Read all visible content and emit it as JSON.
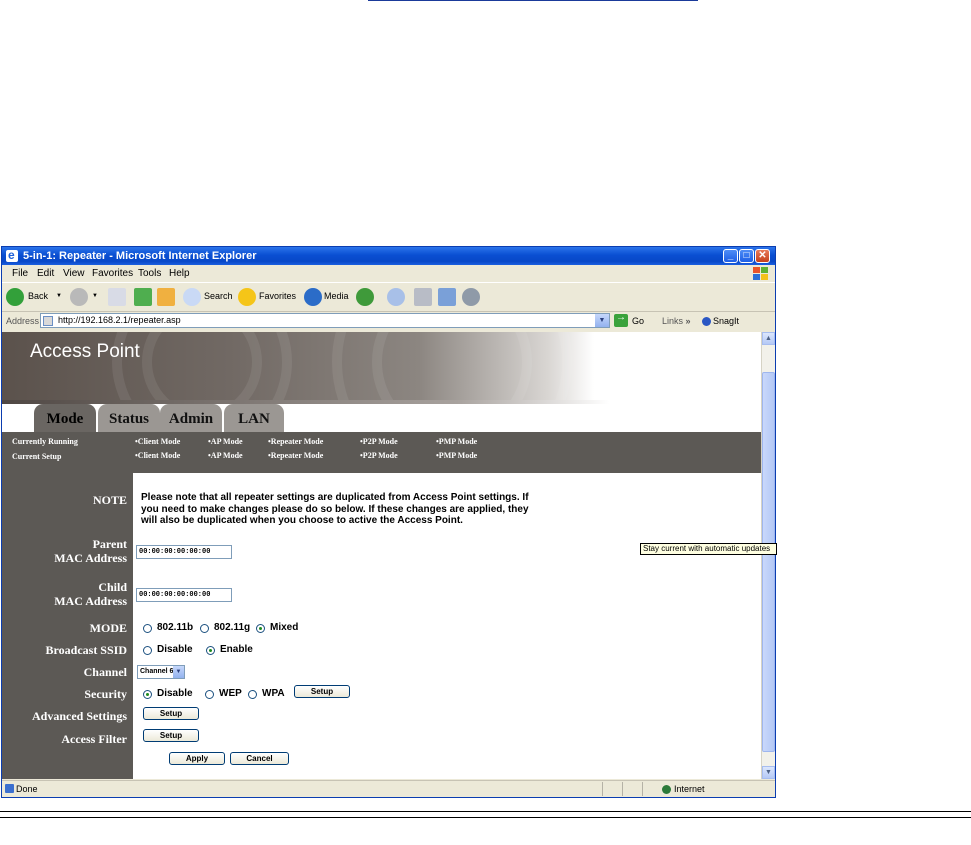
{
  "window": {
    "title": "5-in-1: Repeater - Microsoft Internet Explorer",
    "minimize": "_",
    "maximize": "□",
    "close": "✕"
  },
  "menu": [
    "File",
    "Edit",
    "View",
    "Favorites",
    "Tools",
    "Help"
  ],
  "toolbar": {
    "back": "Back",
    "search": "Search",
    "favorites": "Favorites",
    "media": "Media"
  },
  "address": {
    "label": "Address",
    "url": "http://192.168.2.1/repeater.asp",
    "go": "Go",
    "links": "Links",
    "links_more": "»",
    "snagit": "SnagIt"
  },
  "page": {
    "banner_title": "Access Point",
    "tabs": [
      "Mode",
      "Status",
      "Admin",
      "LAN"
    ],
    "currently_running_label": "Currently Running",
    "current_setup_label": "Current Setup",
    "modes": [
      "•Client Mode",
      "•AP Mode",
      "•Repeater Mode",
      "•P2P Mode",
      "•PMP Mode"
    ],
    "note_label": "NOTE",
    "note_text": "Please note that all repeater settings are duplicated from Access Point settings. If you need to make changes please do so below. If these changes are applied, they will also be duplicated when you choose to active the Access Point.",
    "parent_label_1": "Parent",
    "parent_label_2": "MAC Address",
    "parent_mac": "00:00:00:00:00:00",
    "child_label_1": "Child",
    "child_label_2": "MAC Address",
    "child_mac": "00:00:00:00:00:00",
    "mode_label": "MODE",
    "mode_options": [
      "802.11b",
      "802.11g",
      "Mixed"
    ],
    "mode_selected": "Mixed",
    "ssid_label": "Broadcast SSID",
    "ssid_options": [
      "Disable",
      "Enable"
    ],
    "ssid_selected": "Enable",
    "channel_label": "Channel",
    "channel_value": "Channel 6",
    "security_label": "Security",
    "security_options": [
      "Disable",
      "WEP",
      "WPA"
    ],
    "security_selected": "Disable",
    "setup_button": "Setup",
    "advanced_label": "Advanced Settings",
    "access_filter_label": "Access Filter",
    "apply_button": "Apply",
    "cancel_button": "Cancel"
  },
  "status": {
    "text": "Done",
    "zone": "Internet",
    "tooltip": "Stay current with automatic updates"
  }
}
